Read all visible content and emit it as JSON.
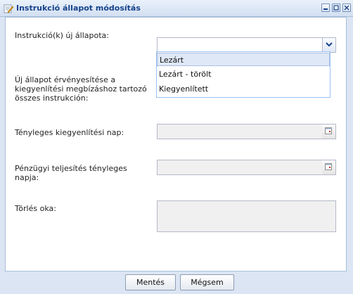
{
  "window": {
    "title": "Instrukció állapot módosítás",
    "controls": [
      "minimize-icon",
      "maximize-icon",
      "close-icon"
    ]
  },
  "form": {
    "status_label": "Instrukció(k) új állapota:",
    "status_value": "",
    "status_options": [
      "Lezárt",
      "Lezárt - törölt",
      "Kiegyenlített"
    ],
    "status_highlighted": "Lezárt",
    "apply_all_label_1": "Új állapot érvényesítése a",
    "apply_all_label_2": "kiegyenlítési megbízáshoz tartozó",
    "apply_all_label_3": "összes instrukción:",
    "settlement_date_label": "Tényleges kiegyenlítési nap:",
    "financial_date_label_1": "Pénzügyi teljesítés tényleges",
    "financial_date_label_2": "napja:",
    "deletion_reason_label": "Törlés oka:"
  },
  "buttons": {
    "save": "Mentés",
    "cancel": "Mégsem"
  },
  "colors": {
    "title_text": "#15428b",
    "window_bg": "#dbe5f3",
    "field_disabled_bg": "#f0f0f0",
    "dropdown_border": "#98c0f4"
  }
}
